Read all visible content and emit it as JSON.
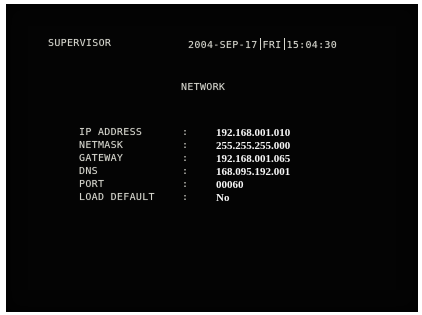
{
  "header": {
    "user": "SUPERVISOR",
    "date": "2004-SEP-17",
    "weekday": "FRI",
    "time": "15:04:30"
  },
  "page_title": "NETWORK",
  "settings": [
    {
      "label": "IP ADDRESS",
      "value": "192.168.001.010"
    },
    {
      "label": "NETMASK",
      "value": "255.255.255.000"
    },
    {
      "label": "GATEWAY",
      "value": "192.168.001.065"
    },
    {
      "label": "DNS",
      "value": "168.095.192.001"
    },
    {
      "label": "PORT",
      "value": "00060"
    },
    {
      "label": "LOAD DEFAULT",
      "value": "No"
    }
  ],
  "separator": ":"
}
